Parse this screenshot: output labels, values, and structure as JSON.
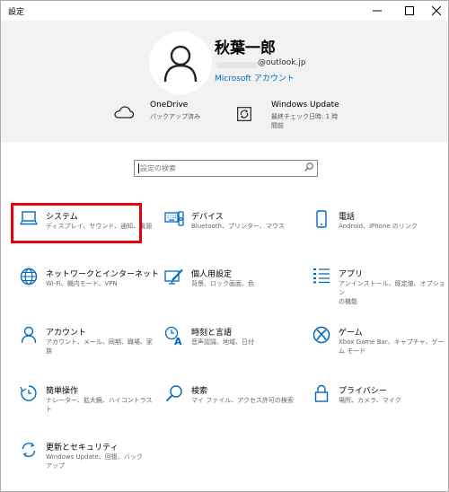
{
  "window": {
    "title": "設定"
  },
  "profile": {
    "name": "秋葉一郎",
    "email": "@outlook.jp",
    "account_link": "Microsoft アカウント"
  },
  "status": [
    {
      "title": "OneDrive",
      "sub": [
        "バックアップ済み"
      ],
      "icon": "cloud-icon"
    },
    {
      "title": "Windows Update",
      "sub": [
        "最終チェック日時: 1 時",
        "間前"
      ],
      "icon": "sync-icon"
    }
  ],
  "search": {
    "placeholder": "設定の検索"
  },
  "tiles": [
    {
      "title": "システム",
      "desc": [
        "ディスプレイ、サウンド、通知、電源"
      ],
      "icon": "laptop-icon"
    },
    {
      "title": "デバイス",
      "desc": [
        "Bluetooth、プリンター、マウス"
      ],
      "icon": "keyboard-icon"
    },
    {
      "title": "電話",
      "desc": [
        "Android、iPhone のリンク"
      ],
      "icon": "phone-icon"
    },
    {
      "title": "ネットワークとインターネット",
      "desc": [
        "Wi-Fi、機内モード、VPN"
      ],
      "icon": "globe-icon"
    },
    {
      "title": "個人用設定",
      "desc": [
        "背景、ロック画面、色"
      ],
      "icon": "personalization-icon"
    },
    {
      "title": "アプリ",
      "desc": [
        "アンインストール、既定値、オプション",
        "の機能"
      ],
      "icon": "apps-icon"
    },
    {
      "title": "アカウント",
      "desc": [
        "アカウント、メール、同期、職場、家",
        "族"
      ],
      "icon": "person-icon"
    },
    {
      "title": "時刻と言語",
      "desc": [
        "音声認識、地域、日付"
      ],
      "icon": "time-language-icon"
    },
    {
      "title": "ゲーム",
      "desc": [
        "Xbox Game Bar、キャプチャ、ゲー",
        "ム モード"
      ],
      "icon": "xbox-icon"
    },
    {
      "title": "簡単操作",
      "desc": [
        "ナレーター、拡大鏡、ハイコントラスト"
      ],
      "icon": "ease-of-access-icon"
    },
    {
      "title": "検索",
      "desc": [
        "マイ ファイル、アクセス許可の検索"
      ],
      "icon": "search-icon"
    },
    {
      "title": "プライバシー",
      "desc": [
        "場所、カメラ、マイク"
      ],
      "icon": "lock-icon"
    },
    {
      "title": "更新とセキュリティ",
      "desc": [
        "Windows Update、回復、バック",
        "アップ"
      ],
      "icon": "update-icon"
    }
  ],
  "colors": {
    "accent": "#0067c0",
    "highlight": "#e8000a",
    "hero_bg": "#f2f2f2"
  }
}
